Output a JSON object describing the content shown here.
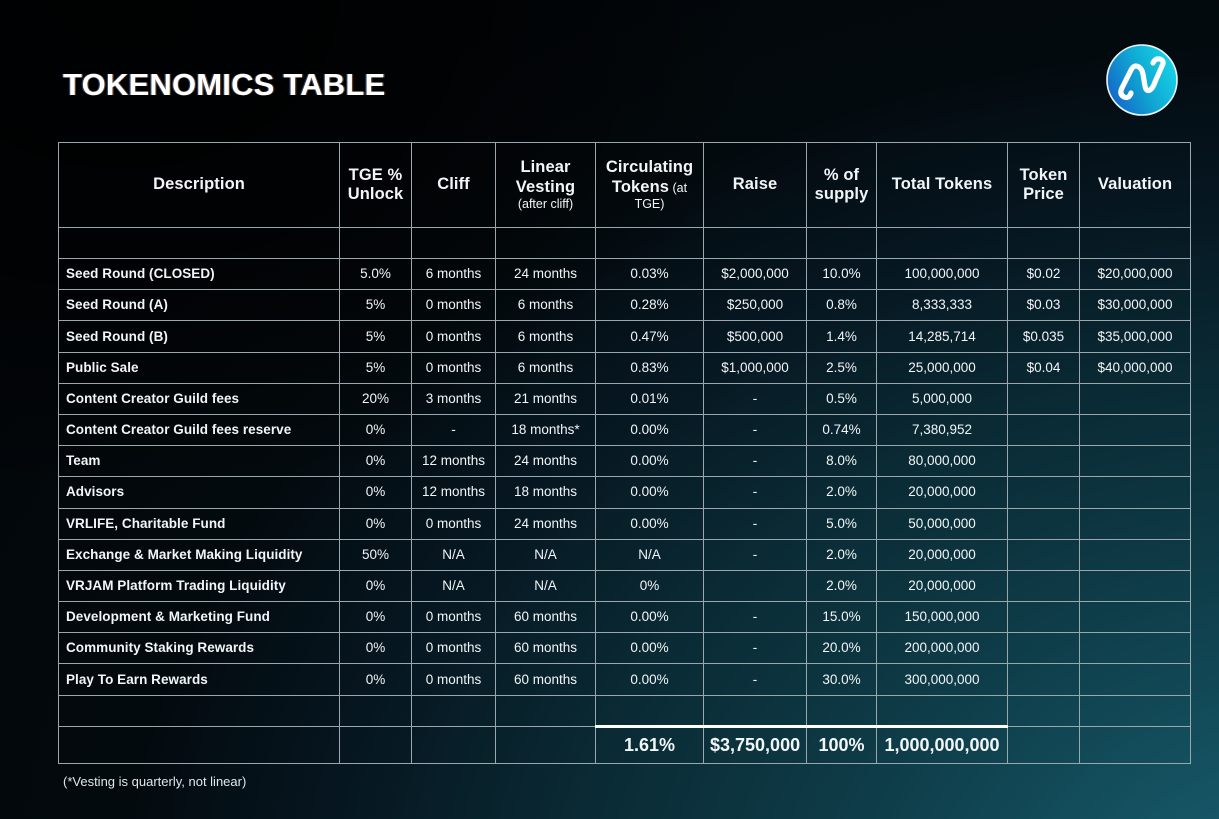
{
  "page": {
    "title": "TOKENOMICS TABLE",
    "footnote": "(*Vesting is quarterly, not linear)",
    "logo_icon": "vrjam-logo-icon",
    "accent_colors": {
      "logo_gradient_start": "#1464c8",
      "logo_gradient_end": "#16d7e8",
      "background_deep_teal": "#14505f",
      "background_black": "#02060a",
      "grid_line": "#9aa7ad",
      "text": "#f2f6f8"
    }
  },
  "table": {
    "columns": [
      {
        "key": "description",
        "label": "Description",
        "sub": ""
      },
      {
        "key": "tge_unlock",
        "label": "TGE %",
        "label2": "Unlock",
        "sub": ""
      },
      {
        "key": "cliff",
        "label": "Cliff",
        "sub": ""
      },
      {
        "key": "linear_vesting",
        "label": "Linear",
        "label2": "Vesting",
        "sub": "(after cliff)"
      },
      {
        "key": "circulating_tokens",
        "label": "Circulating",
        "label2": "Tokens",
        "sub_inline": " (at",
        "sub": "TGE)"
      },
      {
        "key": "raise",
        "label": "Raise",
        "sub": ""
      },
      {
        "key": "pct_of_supply",
        "label": "% of",
        "label2": "supply",
        "sub": ""
      },
      {
        "key": "total_tokens",
        "label": "Total Tokens",
        "sub": ""
      },
      {
        "key": "token_price",
        "label": "Token",
        "label2": "Price",
        "sub": ""
      },
      {
        "key": "valuation",
        "label": "Valuation",
        "sub": ""
      }
    ],
    "rows": [
      {
        "description": "Seed Round (CLOSED)",
        "tge_unlock": "5.0%",
        "cliff": "6 months",
        "linear_vesting": "24 months",
        "circulating_tokens": "0.03%",
        "raise": "$2,000,000",
        "pct_of_supply": "10.0%",
        "total_tokens": "100,000,000",
        "token_price": "$0.02",
        "valuation": "$20,000,000"
      },
      {
        "description": "Seed Round (A)",
        "tge_unlock": "5%",
        "cliff": "0 months",
        "linear_vesting": "6 months",
        "circulating_tokens": "0.28%",
        "raise": "$250,000",
        "pct_of_supply": "0.8%",
        "total_tokens": "8,333,333",
        "token_price": "$0.03",
        "valuation": "$30,000,000"
      },
      {
        "description": "Seed Round (B)",
        "tge_unlock": "5%",
        "cliff": "0 months",
        "linear_vesting": "6 months",
        "circulating_tokens": "0.47%",
        "raise": "$500,000",
        "pct_of_supply": "1.4%",
        "total_tokens": "14,285,714",
        "token_price": "$0.035",
        "valuation": "$35,000,000"
      },
      {
        "description": "Public Sale",
        "tge_unlock": "5%",
        "cliff": "0 months",
        "linear_vesting": "6 months",
        "circulating_tokens": "0.83%",
        "raise": "$1,000,000",
        "pct_of_supply": "2.5%",
        "total_tokens": "25,000,000",
        "token_price": "$0.04",
        "valuation": "$40,000,000"
      },
      {
        "description": "Content Creator Guild fees",
        "tge_unlock": "20%",
        "cliff": "3 months",
        "linear_vesting": "21 months",
        "circulating_tokens": "0.01%",
        "raise": "-",
        "pct_of_supply": "0.5%",
        "total_tokens": "5,000,000",
        "token_price": "",
        "valuation": ""
      },
      {
        "description": "Content Creator Guild fees reserve",
        "tge_unlock": "0%",
        "cliff": "-",
        "linear_vesting": "18 months*",
        "circulating_tokens": "0.00%",
        "raise": "-",
        "pct_of_supply": "0.74%",
        "total_tokens": "7,380,952",
        "token_price": "",
        "valuation": ""
      },
      {
        "description": "Team",
        "tge_unlock": "0%",
        "cliff": "12 months",
        "linear_vesting": "24 months",
        "circulating_tokens": "0.00%",
        "raise": "-",
        "pct_of_supply": "8.0%",
        "total_tokens": "80,000,000",
        "token_price": "",
        "valuation": ""
      },
      {
        "description": "Advisors",
        "tge_unlock": "0%",
        "cliff": "12 months",
        "linear_vesting": "18 months",
        "circulating_tokens": "0.00%",
        "raise": "-",
        "pct_of_supply": "2.0%",
        "total_tokens": "20,000,000",
        "token_price": "",
        "valuation": ""
      },
      {
        "description": "VRLIFE, Charitable Fund",
        "tge_unlock": "0%",
        "cliff": "0 months",
        "linear_vesting": "24 months",
        "circulating_tokens": "0.00%",
        "raise": "-",
        "pct_of_supply": "5.0%",
        "total_tokens": "50,000,000",
        "token_price": "",
        "valuation": ""
      },
      {
        "description": "Exchange & Market Making Liquidity",
        "tge_unlock": "50%",
        "cliff": "N/A",
        "linear_vesting": "N/A",
        "circulating_tokens": "N/A",
        "raise": "-",
        "pct_of_supply": "2.0%",
        "total_tokens": "20,000,000",
        "token_price": "",
        "valuation": ""
      },
      {
        "description": "VRJAM Platform Trading Liquidity",
        "tge_unlock": "0%",
        "cliff": "N/A",
        "linear_vesting": "N/A",
        "circulating_tokens": "0%",
        "raise": "",
        "pct_of_supply": "2.0%",
        "total_tokens": "20,000,000",
        "token_price": "",
        "valuation": ""
      },
      {
        "description": "Development & Marketing Fund",
        "tge_unlock": "0%",
        "cliff": "0 months",
        "linear_vesting": "60 months",
        "circulating_tokens": "0.00%",
        "raise": "-",
        "pct_of_supply": "15.0%",
        "total_tokens": "150,000,000",
        "token_price": "",
        "valuation": ""
      },
      {
        "description": "Community Staking Rewards",
        "tge_unlock": "0%",
        "cliff": "0 months",
        "linear_vesting": "60 months",
        "circulating_tokens": "0.00%",
        "raise": "-",
        "pct_of_supply": "20.0%",
        "total_tokens": "200,000,000",
        "token_price": "",
        "valuation": ""
      },
      {
        "description": "Play To Earn Rewards",
        "tge_unlock": "0%",
        "cliff": "0 months",
        "linear_vesting": "60 months",
        "circulating_tokens": "0.00%",
        "raise": "-",
        "pct_of_supply": "30.0%",
        "total_tokens": "300,000,000",
        "token_price": "",
        "valuation": ""
      }
    ],
    "totals": {
      "description": "",
      "tge_unlock": "",
      "cliff": "",
      "linear_vesting": "",
      "circulating_tokens": "1.61%",
      "raise": "$3,750,000",
      "pct_of_supply": "100%",
      "total_tokens": "1,000,000,000",
      "token_price": "",
      "valuation": ""
    }
  }
}
